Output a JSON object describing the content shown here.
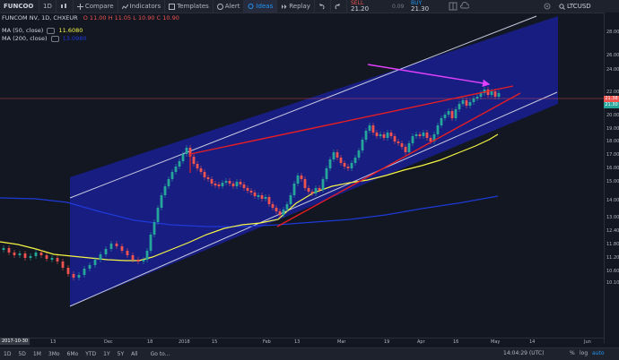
{
  "toolbar": {
    "symbol": "FUNCOO",
    "interval": "1D",
    "compare": "Compare",
    "indicators": "Indicators",
    "templates": "Templates",
    "alert": "Alert",
    "ideas": "Ideas",
    "replay": "Replay",
    "sell_label": "SELL",
    "sell_price": "21.20",
    "spread": "0.09",
    "buy_label": "BUY",
    "buy_price": "21.30",
    "right_symbol": "LTCUSD"
  },
  "legend": {
    "title": "FUNCOM NV, 1D, CHXEUR",
    "ohlc": [
      "O 11.00",
      "H 11.05",
      "L 10.90",
      "C 10.90"
    ],
    "ma50": "MA (50, close)",
    "ma50_value": "11.6080",
    "ma200": "MA (200, close)",
    "ma200_value": "13.0980"
  },
  "yaxis_ticks": [
    "28.00",
    "26.00",
    "24.00",
    "22.00",
    "20.00",
    "19.00",
    "18.00",
    "17.00",
    "16.00",
    "15.00",
    "14.00",
    "13.00",
    "12.40",
    "11.80",
    "11.20",
    "10.60",
    "10.10"
  ],
  "price_labels": [
    {
      "text": "21.38",
      "color": "#ef5350"
    },
    {
      "text": "21.30",
      "color": "#26a69a"
    }
  ],
  "xaxis_ticks": [
    "13",
    "Dec",
    "18",
    "2018",
    "15",
    "Feb",
    "13",
    "Mar",
    "19",
    "Apr",
    "16",
    "May",
    "14",
    "Jun"
  ],
  "x_start_tag": "2017-10-30",
  "bottom": {
    "ranges": [
      "1D",
      "5D",
      "1M",
      "3Mo",
      "6Mo",
      "YTD",
      "1Y",
      "5Y",
      "All"
    ],
    "goto": "Go to...",
    "clock": "14:04:29 (UTC)",
    "options": [
      "%",
      "log",
      "auto"
    ]
  },
  "colors": {
    "channel_fill": "#1a1f9e",
    "channel_border": "#c8cbe0",
    "trend_lines": "#e31e24",
    "arrow": "#e040fb",
    "ma50": "#f5f545",
    "ma200": "#1e3ad8",
    "up_candle": "#26a69a",
    "down_candle": "#ef5350"
  },
  "chart_data": {
    "type": "candlestick",
    "title": "FUNCOM NV, 1D, CHXEUR",
    "x_range": [
      "2017-10-30",
      "2018-06"
    ],
    "ylim": [
      9.8,
      29
    ],
    "series": [
      {
        "name": "MA (50, close)",
        "color": "#f5f545"
      },
      {
        "name": "MA (200, close)",
        "color": "#1e3ad8"
      }
    ],
    "last_values": {
      "open": 11.0,
      "high": 11.05,
      "low": 10.9,
      "close": 10.9
    }
  }
}
